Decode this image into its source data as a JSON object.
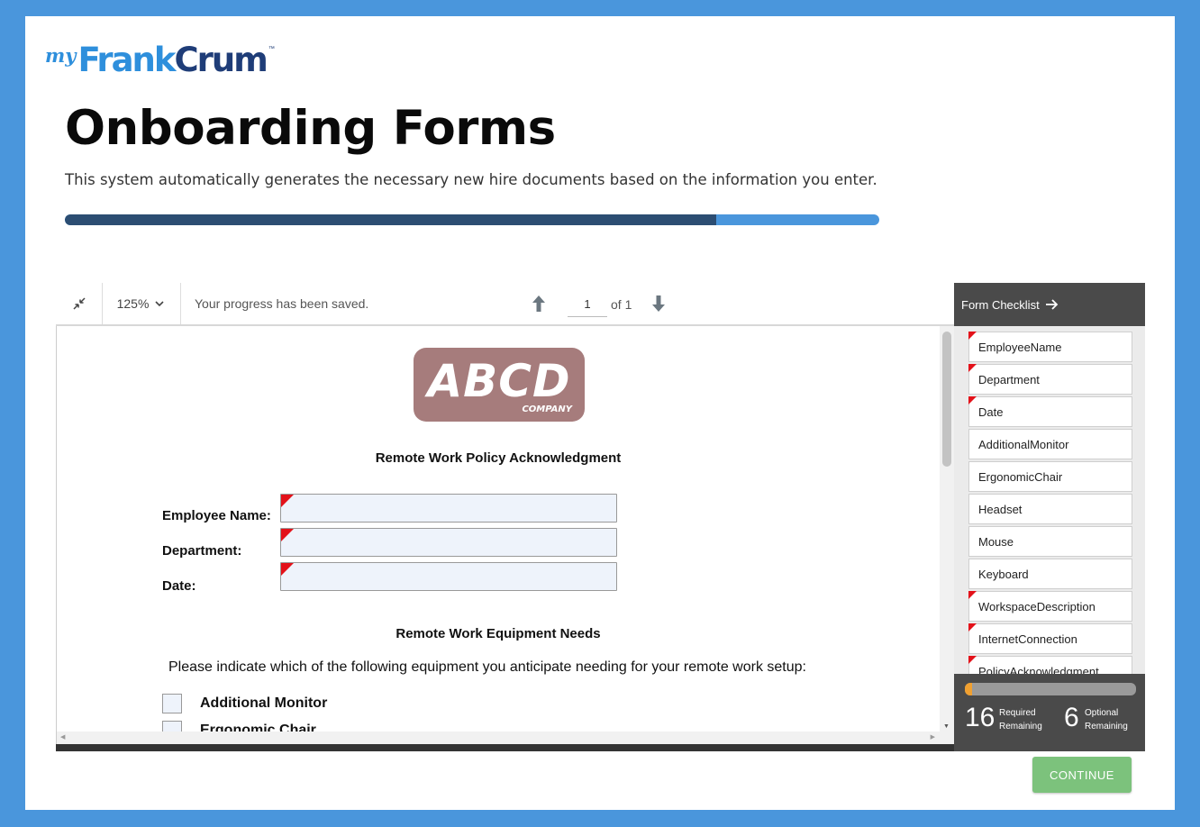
{
  "brand": {
    "prefix": "my",
    "part1": "Frank",
    "part2": "Crum",
    "tm": "™"
  },
  "header": {
    "title": "Onboarding Forms",
    "subtitle": "This system automatically generates the necessary new hire documents based on the information you enter.",
    "progress_fraction": 0.8
  },
  "toolbar": {
    "zoom": "125%",
    "status": "Your progress has been saved.",
    "page_current": "1",
    "page_total": "of 1"
  },
  "document": {
    "company": {
      "name": "ABCD",
      "tag": "COMPANY"
    },
    "title": "Remote Work Policy Acknowledgment",
    "fields": [
      {
        "label": "Employee Name:"
      },
      {
        "label": "Department:"
      },
      {
        "label": "Date:"
      }
    ],
    "equipment_heading": "Remote Work Equipment Needs",
    "instruction": "Please indicate which of the following equipment you anticipate needing for your remote work setup:",
    "checkboxes": [
      {
        "label": "Additional Monitor"
      },
      {
        "label": "Ergonomic Chair"
      }
    ]
  },
  "checklist": {
    "title": "Form Checklist",
    "items": [
      {
        "label": "EmployeeName",
        "required": true
      },
      {
        "label": "Department",
        "required": true
      },
      {
        "label": "Date",
        "required": true
      },
      {
        "label": "AdditionalMonitor",
        "required": false
      },
      {
        "label": "ErgonomicChair",
        "required": false
      },
      {
        "label": "Headset",
        "required": false
      },
      {
        "label": "Mouse",
        "required": false
      },
      {
        "label": "Keyboard",
        "required": false
      },
      {
        "label": "WorkspaceDescription",
        "required": true
      },
      {
        "label": "InternetConnection",
        "required": true
      },
      {
        "label": "PolicyAcknowledgment",
        "required": true
      }
    ],
    "progress_fraction": 0.04,
    "required_count": "16",
    "required_label_1": "Required",
    "required_label_2": "Remaining",
    "optional_count": "6",
    "optional_label_1": "Optional",
    "optional_label_2": "Remaining"
  },
  "continue_label": "CONTINUE",
  "colors": {
    "background": "#4a96dc",
    "progress_track": "#4a96dc",
    "progress_fill": "#2c4d72",
    "required_flag": "#e3121a",
    "continue_button": "#7cc27c",
    "checklist_bar_fill": "#f0a030"
  }
}
